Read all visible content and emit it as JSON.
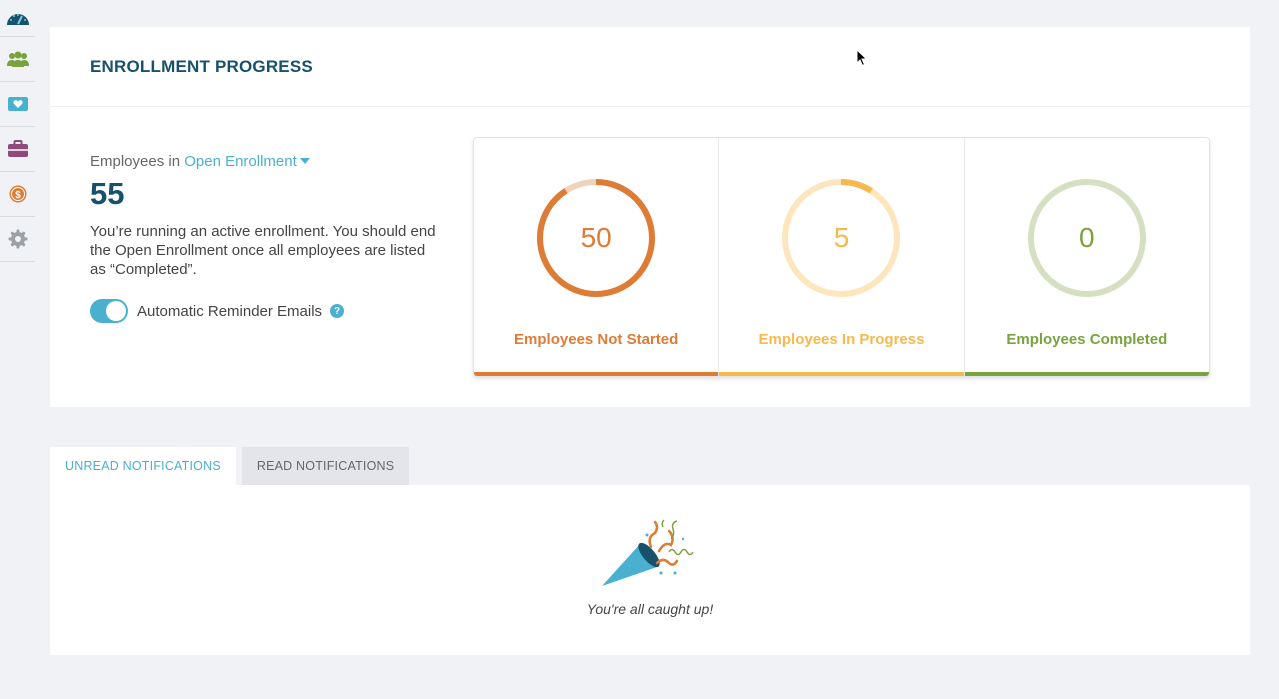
{
  "sidebar": {
    "items": [
      {
        "name": "dashboard-icon"
      },
      {
        "name": "employees-icon"
      },
      {
        "name": "benefits-heart-icon"
      },
      {
        "name": "briefcase-icon"
      },
      {
        "name": "dollar-coin-icon"
      },
      {
        "name": "settings-gear-icon"
      }
    ]
  },
  "enrollment": {
    "title": "ENROLLMENT PROGRESS",
    "employees_in_label": "Employees in",
    "enrollment_type": "Open Enrollment",
    "employee_count": "55",
    "description": "You’re running an active enrollment. You should end the Open Enrollment once all employees are listed as “Completed”.",
    "reminder_label": "Automatic Reminder Emails",
    "reminder_enabled": true,
    "help_symbol": "?"
  },
  "stats": [
    {
      "value": "50",
      "label": "Employees Not Started",
      "fraction": 0.909,
      "color": "#de7b35",
      "track": "#f0d3bd"
    },
    {
      "value": "5",
      "label": "Employees In Progress",
      "fraction": 0.091,
      "color": "#f6b94e",
      "track": "#fde6bd"
    },
    {
      "value": "0",
      "label": "Employees Completed",
      "fraction": 0,
      "color": "#79a33e",
      "track": "#d5e0c2"
    }
  ],
  "tabs": {
    "unread": "UNREAD NOTIFICATIONS",
    "read": "READ NOTIFICATIONS"
  },
  "notifications": {
    "empty_message": "You're all caught up!"
  },
  "colors": {
    "brand_dark": "#17516b",
    "accent": "#4ab0cf"
  }
}
